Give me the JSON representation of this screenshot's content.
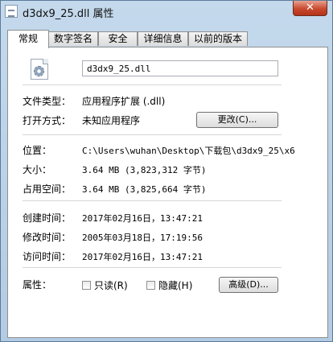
{
  "window": {
    "title": "d3dx9_25.dll 属性",
    "close_label": "✕"
  },
  "tabs": [
    {
      "label": "常规",
      "active": true
    },
    {
      "label": "数字签名"
    },
    {
      "label": "安全"
    },
    {
      "label": "详细信息"
    },
    {
      "label": "以前的版本"
    }
  ],
  "general": {
    "file_name": "d3dx9_25.dll",
    "file_type_label": "文件类型：",
    "file_type_value": "应用程序扩展 (.dll)",
    "open_with_label": "打开方式：",
    "open_with_value": "未知应用程序",
    "change_button": "更改(C)...",
    "location_label": "位置：",
    "location_value": "C:\\Users\\wuhan\\Desktop\\下载包\\d3dx9_25\\x6",
    "size_label": "大小：",
    "size_value": "3.64 MB (3,823,312 字节)",
    "disk_size_label": "占用空间：",
    "disk_size_value": "3.64 MB (3,825,664 字节)",
    "created_label": "创建时间：",
    "created_value": "2017年02月16日，13:47:21",
    "modified_label": "修改时间：",
    "modified_value": "2005年03月18日，17:19:56",
    "accessed_label": "访问时间：",
    "accessed_value": "2017年02月16日，13:47:21",
    "attributes_label": "属性：",
    "readonly_label": "只读(R)",
    "hidden_label": "隐藏(H)",
    "advanced_button": "高级(D)..."
  },
  "icons": {
    "app": "dll-file-icon",
    "file": "settings-file-icon"
  }
}
